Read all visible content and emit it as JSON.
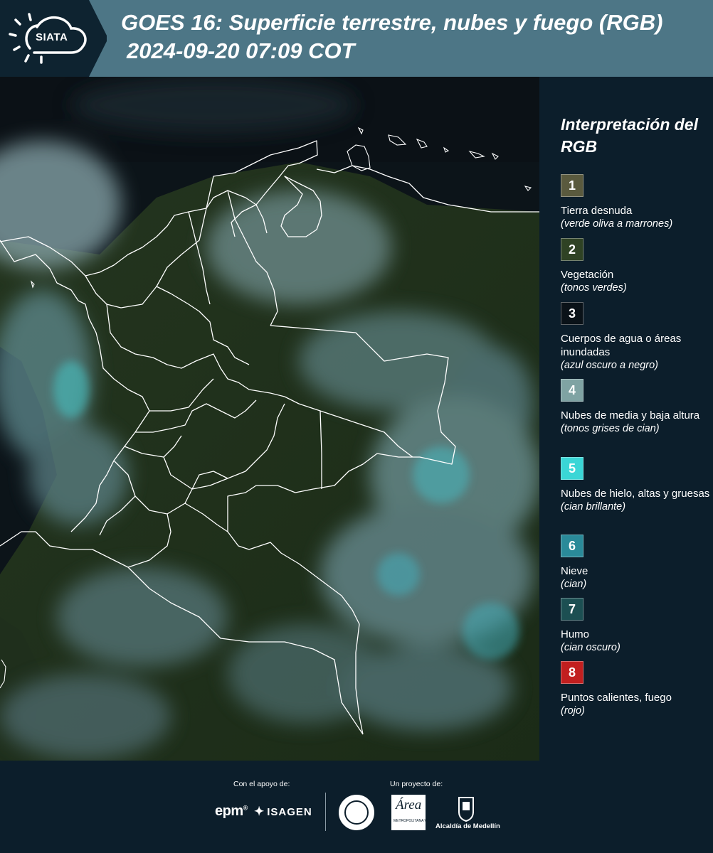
{
  "header": {
    "logo_text": "SIATA",
    "title_line1": "GOES 16: Superficie terrestre, nubes y fuego (RGB)",
    "title_line2": "2024-09-20 07:09 COT"
  },
  "legend": {
    "title": "Interpretación del RGB",
    "items": [
      {
        "num": "1",
        "color": "#5a5a3e",
        "label": "Tierra desnuda",
        "desc": "(verde oliva a marrones)"
      },
      {
        "num": "2",
        "color": "#2f4224",
        "label": "Vegetación",
        "desc": "(tonos verdes)"
      },
      {
        "num": "3",
        "color": "#0a1218",
        "label": "Cuerpos de agua o áreas inundadas",
        "desc": "(azul oscuro a negro)"
      },
      {
        "num": "4",
        "color": "#7fa3a3",
        "label": "Nubes de media y baja altura",
        "desc": "(tonos grises de cian)"
      },
      {
        "num": "5",
        "color": "#3ad6d6",
        "label": "Nubes de hielo, altas y gruesas",
        "desc": "(cian brillante)"
      },
      {
        "num": "6",
        "color": "#2a8a99",
        "label": "Nieve",
        "desc": "(cian)"
      },
      {
        "num": "7",
        "color": "#1c4f52",
        "label": "Humo",
        "desc": "(cian oscuro)"
      },
      {
        "num": "8",
        "color": "#c21f1f",
        "label": "Puntos calientes, fuego",
        "desc": "(rojo)"
      }
    ]
  },
  "footer": {
    "support_label": "Con el apoyo de:",
    "project_label": "Un proyecto de:",
    "sponsors": [
      "epm",
      "ISAGEN"
    ],
    "area_logo_text": "Área",
    "area_logo_sub": "METROPOLITANA Valle de Aburrá",
    "alcaldia_text": "Alcaldía de Medellín"
  }
}
